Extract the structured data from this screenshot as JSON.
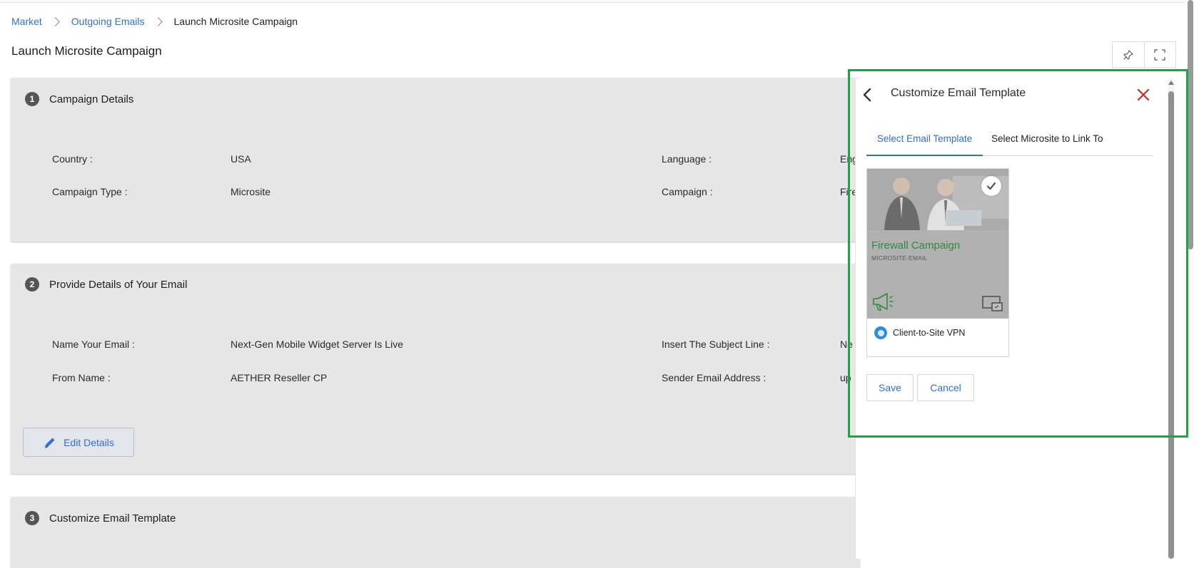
{
  "breadcrumb": {
    "items": [
      "Market",
      "Outgoing Emails"
    ],
    "current": "Launch Microsite Campaign"
  },
  "page_title": "Launch Microsite Campaign",
  "sections": {
    "campaign": {
      "number": "1",
      "title": "Campaign Details",
      "country_label": "Country :",
      "country_value": "USA",
      "language_label": "Language :",
      "language_value": "Eng",
      "type_label": "Campaign Type :",
      "type_value": "Microsite",
      "campaign_label": "Campaign :",
      "campaign_value": "Fire"
    },
    "email": {
      "number": "2",
      "title": "Provide Details of Your Email",
      "name_label": "Name Your Email :",
      "name_value": "Next-Gen Mobile Widget Server Is Live",
      "subject_label": "Insert The Subject Line :",
      "subject_value": "Ne",
      "from_label": "From Name :",
      "from_value": "AETHER Reseller CP",
      "sender_label": "Sender Email Address :",
      "sender_value": "up",
      "edit_label": "Edit Details"
    },
    "customize": {
      "number": "3",
      "title": "Customize Email Template"
    }
  },
  "panel": {
    "title": "Customize Email Template",
    "tabs": [
      "Select Email Template",
      "Select Microsite to Link To"
    ],
    "template": {
      "title": "Firewall Campaign",
      "subtitle": "MICROSITE-EMAIL",
      "option_label": "Client-to-Site VPN"
    },
    "save_label": "Save",
    "cancel_label": "Cancel"
  },
  "colors": {
    "accent": "#2f6fd6",
    "highlight": "#21a04a",
    "close": "#d9262b",
    "template_title": "#2f8a3e"
  },
  "icons": [
    "chevron-right-icon",
    "pin-icon",
    "expand-icon",
    "pencil-icon",
    "back-arrow-icon",
    "close-icon",
    "check-icon",
    "megaphone-icon",
    "screen-icon"
  ]
}
